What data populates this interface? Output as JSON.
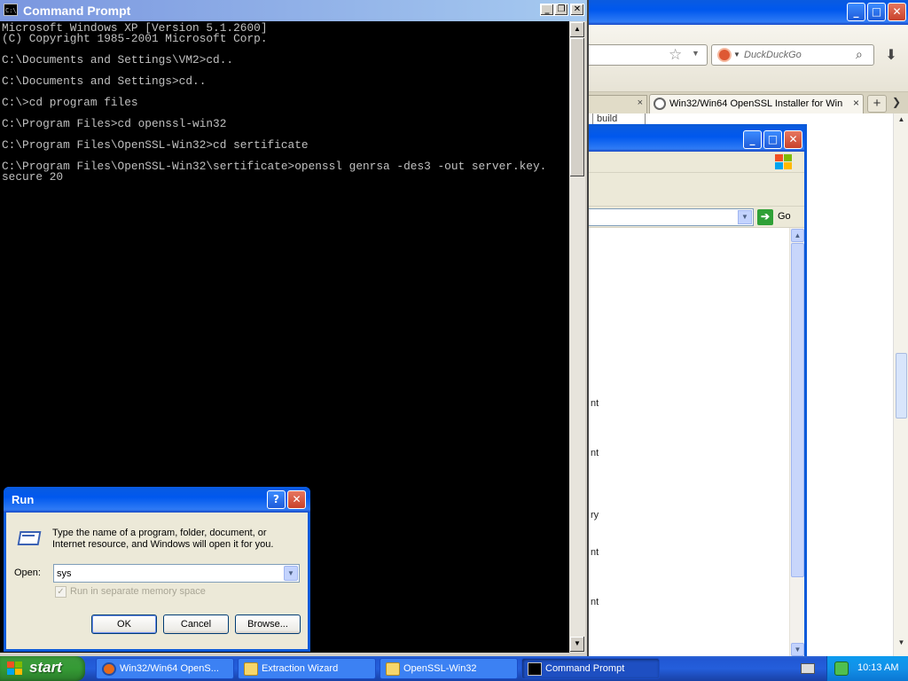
{
  "firefox": {
    "search_placeholder": "DuckDuckGo",
    "tab_inactive_close": "×",
    "tab_active_label": "Win32/Win64 OpenSSL Installer for Win...",
    "tab_active_close": "×",
    "new_tab": "+",
    "tab_scroll": "❯",
    "build_fragment": "build",
    "controls": {
      "minimize": "_",
      "maximize": "□",
      "close": "✕"
    }
  },
  "explorer": {
    "go_label": "Go",
    "content_fragments": [
      "nt",
      "nt",
      "ry",
      "nt",
      "nt"
    ],
    "controls": {
      "minimize": "_",
      "maximize": "□",
      "close": "✕"
    }
  },
  "cmd": {
    "title": "Command Prompt",
    "icon_text": "C:\\",
    "lines": [
      "Microsoft Windows XP [Version 5.1.2600]",
      "(C) Copyright 1985-2001 Microsoft Corp.",
      "",
      "C:\\Documents and Settings\\VM2>cd..",
      "",
      "C:\\Documents and Settings>cd..",
      "",
      "C:\\>cd program files",
      "",
      "C:\\Program Files>cd openssl-win32",
      "",
      "C:\\Program Files\\OpenSSL-Win32>cd sertificate",
      "",
      "C:\\Program Files\\OpenSSL-Win32\\sertificate>openssl genrsa -des3 -out server.key.",
      "secure 20"
    ],
    "controls": {
      "minimize": "_",
      "maximize": "❐",
      "close": "✕"
    }
  },
  "run_dialog": {
    "title": "Run",
    "description": "Type the name of a program, folder, document, or Internet resource, and Windows will open it for you.",
    "open_label": "Open:",
    "open_value": "sys",
    "checkbox_label": "Run in separate memory space",
    "ok_label": "OK",
    "cancel_label": "Cancel",
    "browse_label": "Browse...",
    "help_label": "?",
    "close_label": "✕"
  },
  "taskbar": {
    "start_label": "start",
    "tasks": [
      {
        "label": "Win32/Win64 OpenS..."
      },
      {
        "label": "Extraction Wizard"
      },
      {
        "label": "OpenSSL-Win32"
      },
      {
        "label": "Command Prompt"
      }
    ],
    "clock": "10:13 AM"
  }
}
